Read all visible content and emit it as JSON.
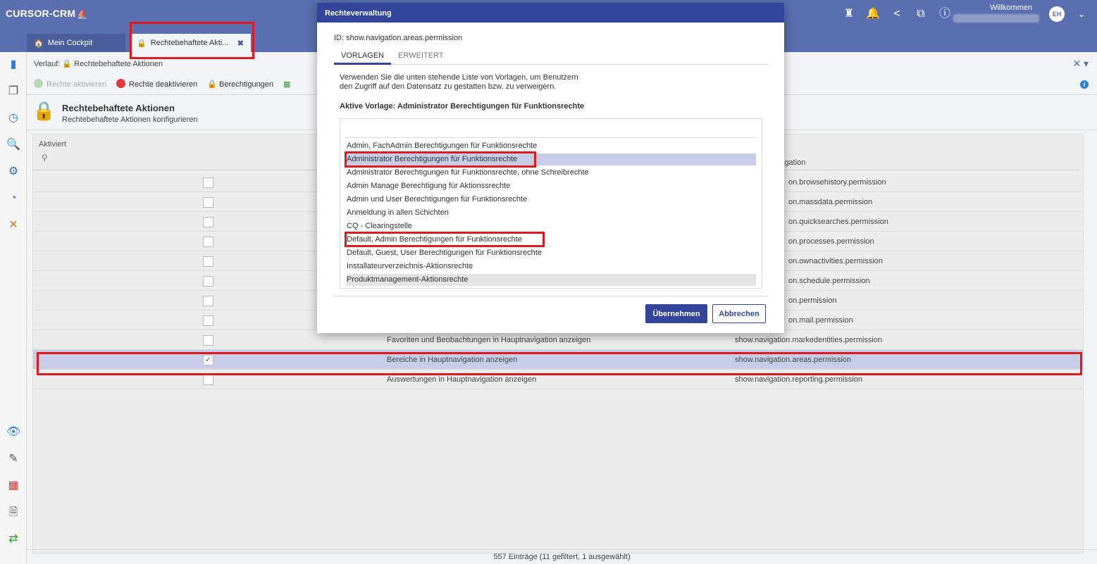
{
  "app": {
    "brand": "CURSOR-CRM",
    "welcome_label": "Willkommen",
    "avatar_initials": "EH"
  },
  "tabs": [
    {
      "label": "Mein Cockpit"
    },
    {
      "label": "Rechtebehaftete Akti...",
      "close": "✖"
    }
  ],
  "breadcrumb": {
    "prefix": "Verlauf:",
    "item": "Rechtebehaftete Aktionen"
  },
  "toolbar": {
    "activate": "Rechte aktivieren",
    "deactivate": "Rechte deaktivieren",
    "permissions": "Berechtigungen"
  },
  "page": {
    "title": "Rechtebehaftete Aktionen",
    "subtitle": "Rechtebehaftete Aktionen konfigurieren"
  },
  "grid": {
    "col_aktiviert": "Aktiviert",
    "col_navigation": "igation",
    "rows": [
      {
        "checked": false,
        "description": "",
        "navigation": "on.browsehistory.permission"
      },
      {
        "checked": false,
        "description": "",
        "navigation": "on.massdata.permission"
      },
      {
        "checked": false,
        "description": "",
        "navigation": "on.quicksearches.permission"
      },
      {
        "checked": false,
        "description": "",
        "navigation": "on.processes.permission"
      },
      {
        "checked": false,
        "description": "",
        "navigation": "on.ownactivities.permission"
      },
      {
        "checked": false,
        "description": "",
        "navigation": "on.schedule.permission"
      },
      {
        "checked": false,
        "description": "",
        "navigation": "on.permission"
      },
      {
        "checked": false,
        "description": "",
        "navigation": "on.mail.permission"
      },
      {
        "checked": false,
        "description": "Favoriten und Beobachtungen in Hauptnavigation anzeigen",
        "navigation": "show.navigation.markedentities.permission"
      },
      {
        "checked": true,
        "description": "Bereiche in Hauptnavigation anzeigen",
        "navigation": "show.navigation.areas.permission"
      },
      {
        "checked": false,
        "description": "Auswertungen in Hauptnavigation anzeigen",
        "navigation": "show.navigation.reporting.permission"
      }
    ],
    "footer": "557 Einträge (11 gefiltert, 1 ausgewählt)"
  },
  "dialog": {
    "title": "Rechteverwaltung",
    "id_text": "ID: show.navigation.areas.permission",
    "tabs": [
      "VORLAGEN",
      "ERWEITERT"
    ],
    "text_line1": "Verwenden Sie die unten stehende Liste von Vorlagen, um Benutzern",
    "text_line2": "den Zugriff auf den Datensatz zu gestatten bzw. zu verweigern.",
    "active_template": "Aktive Vorlage: Administrator Berechtigungen für Funktionsrechte",
    "templates": [
      "Admin, FachAdmin Berechtigungen für Funktionsrechte",
      "Administrator Berechtigungen für Funktionsrechte",
      "Administrator Berechtigungen für Funktionsrechte, ohne Schreibrechte",
      "Admin Manage Berechtigung für Aktionssrechte",
      "Admin und User Berechtigungen für Funktionsrechte",
      "Anmeldung in allen Schichten",
      "CQ - Clearingstelle",
      "Default, Admin Berechtigungen für Funktionsrechte",
      "Default, Guest, User Berechtigungen für Funktionsrechte",
      "Installateurverzeichnis-Aktionsrechte",
      "Produktmanagement-Aktionsrechte"
    ],
    "ok_label": "Übernehmen",
    "cancel_label": "Abbrechen"
  },
  "colors": {
    "header_bg": "#5a6fb0",
    "dialog_title_bg": "#33449b",
    "selection_bg": "#c7cde6",
    "highlight_frame": "#e0191e"
  }
}
